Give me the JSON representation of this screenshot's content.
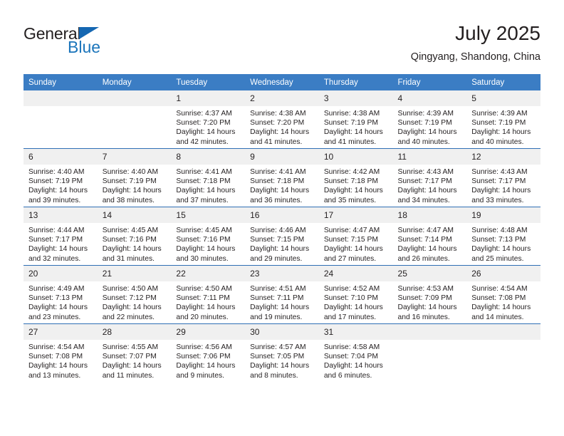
{
  "brand": {
    "name_part1": "General",
    "name_part2": "Blue",
    "accent_color": "#1b75bb",
    "header_color": "#3b7dc4"
  },
  "header": {
    "title": "July 2025",
    "subtitle": "Qingyang, Shandong, China"
  },
  "weekdays": [
    "Sunday",
    "Monday",
    "Tuesday",
    "Wednesday",
    "Thursday",
    "Friday",
    "Saturday"
  ],
  "labels": {
    "sunrise_prefix": "Sunrise:",
    "sunset_prefix": "Sunset:",
    "daylight_prefix": "Daylight:"
  },
  "weeks": [
    [
      {
        "day": "",
        "empty": true
      },
      {
        "day": "",
        "empty": true
      },
      {
        "day": "1",
        "sunrise": "Sunrise: 4:37 AM",
        "sunset": "Sunset: 7:20 PM",
        "daylight_line1": "Daylight: 14 hours",
        "daylight_line2": "and 42 minutes."
      },
      {
        "day": "2",
        "sunrise": "Sunrise: 4:38 AM",
        "sunset": "Sunset: 7:20 PM",
        "daylight_line1": "Daylight: 14 hours",
        "daylight_line2": "and 41 minutes."
      },
      {
        "day": "3",
        "sunrise": "Sunrise: 4:38 AM",
        "sunset": "Sunset: 7:19 PM",
        "daylight_line1": "Daylight: 14 hours",
        "daylight_line2": "and 41 minutes."
      },
      {
        "day": "4",
        "sunrise": "Sunrise: 4:39 AM",
        "sunset": "Sunset: 7:19 PM",
        "daylight_line1": "Daylight: 14 hours",
        "daylight_line2": "and 40 minutes."
      },
      {
        "day": "5",
        "sunrise": "Sunrise: 4:39 AM",
        "sunset": "Sunset: 7:19 PM",
        "daylight_line1": "Daylight: 14 hours",
        "daylight_line2": "and 40 minutes."
      }
    ],
    [
      {
        "day": "6",
        "sunrise": "Sunrise: 4:40 AM",
        "sunset": "Sunset: 7:19 PM",
        "daylight_line1": "Daylight: 14 hours",
        "daylight_line2": "and 39 minutes."
      },
      {
        "day": "7",
        "sunrise": "Sunrise: 4:40 AM",
        "sunset": "Sunset: 7:19 PM",
        "daylight_line1": "Daylight: 14 hours",
        "daylight_line2": "and 38 minutes."
      },
      {
        "day": "8",
        "sunrise": "Sunrise: 4:41 AM",
        "sunset": "Sunset: 7:18 PM",
        "daylight_line1": "Daylight: 14 hours",
        "daylight_line2": "and 37 minutes."
      },
      {
        "day": "9",
        "sunrise": "Sunrise: 4:41 AM",
        "sunset": "Sunset: 7:18 PM",
        "daylight_line1": "Daylight: 14 hours",
        "daylight_line2": "and 36 minutes."
      },
      {
        "day": "10",
        "sunrise": "Sunrise: 4:42 AM",
        "sunset": "Sunset: 7:18 PM",
        "daylight_line1": "Daylight: 14 hours",
        "daylight_line2": "and 35 minutes."
      },
      {
        "day": "11",
        "sunrise": "Sunrise: 4:43 AM",
        "sunset": "Sunset: 7:17 PM",
        "daylight_line1": "Daylight: 14 hours",
        "daylight_line2": "and 34 minutes."
      },
      {
        "day": "12",
        "sunrise": "Sunrise: 4:43 AM",
        "sunset": "Sunset: 7:17 PM",
        "daylight_line1": "Daylight: 14 hours",
        "daylight_line2": "and 33 minutes."
      }
    ],
    [
      {
        "day": "13",
        "sunrise": "Sunrise: 4:44 AM",
        "sunset": "Sunset: 7:17 PM",
        "daylight_line1": "Daylight: 14 hours",
        "daylight_line2": "and 32 minutes."
      },
      {
        "day": "14",
        "sunrise": "Sunrise: 4:45 AM",
        "sunset": "Sunset: 7:16 PM",
        "daylight_line1": "Daylight: 14 hours",
        "daylight_line2": "and 31 minutes."
      },
      {
        "day": "15",
        "sunrise": "Sunrise: 4:45 AM",
        "sunset": "Sunset: 7:16 PM",
        "daylight_line1": "Daylight: 14 hours",
        "daylight_line2": "and 30 minutes."
      },
      {
        "day": "16",
        "sunrise": "Sunrise: 4:46 AM",
        "sunset": "Sunset: 7:15 PM",
        "daylight_line1": "Daylight: 14 hours",
        "daylight_line2": "and 29 minutes."
      },
      {
        "day": "17",
        "sunrise": "Sunrise: 4:47 AM",
        "sunset": "Sunset: 7:15 PM",
        "daylight_line1": "Daylight: 14 hours",
        "daylight_line2": "and 27 minutes."
      },
      {
        "day": "18",
        "sunrise": "Sunrise: 4:47 AM",
        "sunset": "Sunset: 7:14 PM",
        "daylight_line1": "Daylight: 14 hours",
        "daylight_line2": "and 26 minutes."
      },
      {
        "day": "19",
        "sunrise": "Sunrise: 4:48 AM",
        "sunset": "Sunset: 7:13 PM",
        "daylight_line1": "Daylight: 14 hours",
        "daylight_line2": "and 25 minutes."
      }
    ],
    [
      {
        "day": "20",
        "sunrise": "Sunrise: 4:49 AM",
        "sunset": "Sunset: 7:13 PM",
        "daylight_line1": "Daylight: 14 hours",
        "daylight_line2": "and 23 minutes."
      },
      {
        "day": "21",
        "sunrise": "Sunrise: 4:50 AM",
        "sunset": "Sunset: 7:12 PM",
        "daylight_line1": "Daylight: 14 hours",
        "daylight_line2": "and 22 minutes."
      },
      {
        "day": "22",
        "sunrise": "Sunrise: 4:50 AM",
        "sunset": "Sunset: 7:11 PM",
        "daylight_line1": "Daylight: 14 hours",
        "daylight_line2": "and 20 minutes."
      },
      {
        "day": "23",
        "sunrise": "Sunrise: 4:51 AM",
        "sunset": "Sunset: 7:11 PM",
        "daylight_line1": "Daylight: 14 hours",
        "daylight_line2": "and 19 minutes."
      },
      {
        "day": "24",
        "sunrise": "Sunrise: 4:52 AM",
        "sunset": "Sunset: 7:10 PM",
        "daylight_line1": "Daylight: 14 hours",
        "daylight_line2": "and 17 minutes."
      },
      {
        "day": "25",
        "sunrise": "Sunrise: 4:53 AM",
        "sunset": "Sunset: 7:09 PM",
        "daylight_line1": "Daylight: 14 hours",
        "daylight_line2": "and 16 minutes."
      },
      {
        "day": "26",
        "sunrise": "Sunrise: 4:54 AM",
        "sunset": "Sunset: 7:08 PM",
        "daylight_line1": "Daylight: 14 hours",
        "daylight_line2": "and 14 minutes."
      }
    ],
    [
      {
        "day": "27",
        "sunrise": "Sunrise: 4:54 AM",
        "sunset": "Sunset: 7:08 PM",
        "daylight_line1": "Daylight: 14 hours",
        "daylight_line2": "and 13 minutes."
      },
      {
        "day": "28",
        "sunrise": "Sunrise: 4:55 AM",
        "sunset": "Sunset: 7:07 PM",
        "daylight_line1": "Daylight: 14 hours",
        "daylight_line2": "and 11 minutes."
      },
      {
        "day": "29",
        "sunrise": "Sunrise: 4:56 AM",
        "sunset": "Sunset: 7:06 PM",
        "daylight_line1": "Daylight: 14 hours",
        "daylight_line2": "and 9 minutes."
      },
      {
        "day": "30",
        "sunrise": "Sunrise: 4:57 AM",
        "sunset": "Sunset: 7:05 PM",
        "daylight_line1": "Daylight: 14 hours",
        "daylight_line2": "and 8 minutes."
      },
      {
        "day": "31",
        "sunrise": "Sunrise: 4:58 AM",
        "sunset": "Sunset: 7:04 PM",
        "daylight_line1": "Daylight: 14 hours",
        "daylight_line2": "and 6 minutes."
      },
      {
        "day": "",
        "empty": true
      },
      {
        "day": "",
        "empty": true
      }
    ]
  ]
}
